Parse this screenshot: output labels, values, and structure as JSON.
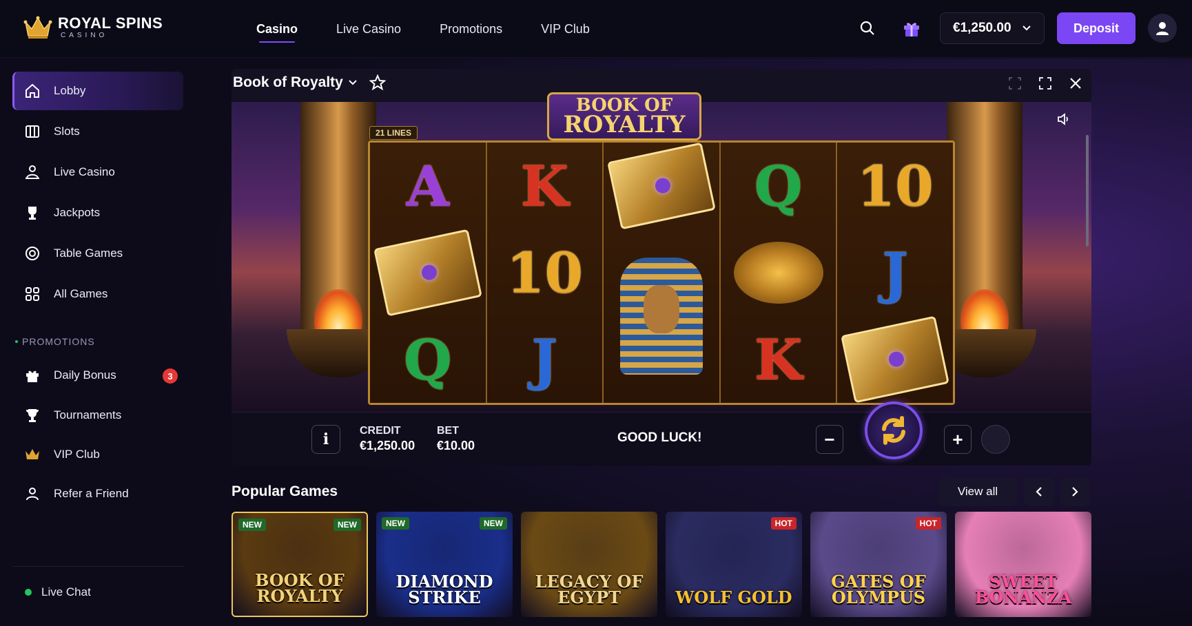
{
  "brand": {
    "name": "ROYAL SPINS",
    "sub": "CASINO"
  },
  "topnav": [
    {
      "label": "Casino",
      "active": true
    },
    {
      "label": "Live Casino"
    },
    {
      "label": "Promotions"
    },
    {
      "label": "VIP Club"
    }
  ],
  "header": {
    "balance": "€1,250.00",
    "deposit_label": "Deposit",
    "icons": [
      "search-icon",
      "gift-icon",
      "chevron-down-icon",
      "user-icon"
    ]
  },
  "sidebar": {
    "items": [
      {
        "label": "Lobby",
        "icon": "home-icon",
        "active": true
      },
      {
        "label": "Slots",
        "icon": "slots-icon"
      },
      {
        "label": "Live Casino",
        "icon": "dealer-icon"
      },
      {
        "label": "Jackpots",
        "icon": "trophy-icon"
      },
      {
        "label": "Table Games",
        "icon": "chip-icon"
      },
      {
        "label": "All Games",
        "icon": "grid-icon"
      }
    ],
    "section_label": "PROMOTIONS",
    "promo_items": [
      {
        "label": "Daily Bonus",
        "icon": "gift-icon",
        "badge": "3"
      },
      {
        "label": "Tournaments",
        "icon": "cup-icon"
      },
      {
        "label": "VIP Club",
        "icon": "crown-icon"
      },
      {
        "label": "Refer a Friend",
        "icon": "user-icon"
      }
    ],
    "live_chat": "Live Chat"
  },
  "game": {
    "title": "Book of Royalty",
    "logo_line1": "BOOK OF",
    "logo_line2": "ROYALTY",
    "lines_tag": "21 LINES",
    "reels": [
      [
        "A",
        "book",
        "Q"
      ],
      [
        "K",
        "10",
        "J"
      ],
      [
        "book",
        "pharaoh",
        "pharaoh"
      ],
      [
        "Q",
        "scarab",
        "K"
      ],
      [
        "10",
        "J",
        "book"
      ]
    ],
    "credit_label": "CREDIT",
    "credit_value": "€1,250.00",
    "bet_label": "BET",
    "bet_value": "€10.00",
    "status": "GOOD LUCK!",
    "info_label": "i",
    "minus_label": "−",
    "plus_label": "+"
  },
  "popular": {
    "title": "Popular Games",
    "view_all": "View all",
    "games": [
      {
        "name": "BOOK OF ROYALTY",
        "tags": [
          {
            "text": "NEW",
            "side": "l"
          },
          {
            "text": "NEW",
            "side": "r"
          }
        ],
        "selected": true,
        "bg": "#5a3a10",
        "color": "#f3d27a"
      },
      {
        "name": "DIAMOND STRIKE",
        "tags": [
          {
            "text": "NEW",
            "side": "l"
          },
          {
            "text": "NEW",
            "side": "r"
          }
        ],
        "bg": "#1a2e8a",
        "color": "#ffffff"
      },
      {
        "name": "LEGACY OF EGYPT",
        "tags": [],
        "bg": "#6b4a14",
        "color": "#f2d792"
      },
      {
        "name": "WOLF GOLD",
        "tags": [
          {
            "text": "HOT",
            "side": "r"
          }
        ],
        "bg": "#2a2b60",
        "color": "#f5c030"
      },
      {
        "name": "GATES OF OLYMPUS",
        "tags": [
          {
            "text": "HOT",
            "side": "r"
          }
        ],
        "bg": "#5a4a8a",
        "color": "#ffd34a"
      },
      {
        "name": "SWEET BONANZA",
        "tags": [],
        "bg": "#e57fb5",
        "color": "#ff4f9a"
      }
    ]
  }
}
